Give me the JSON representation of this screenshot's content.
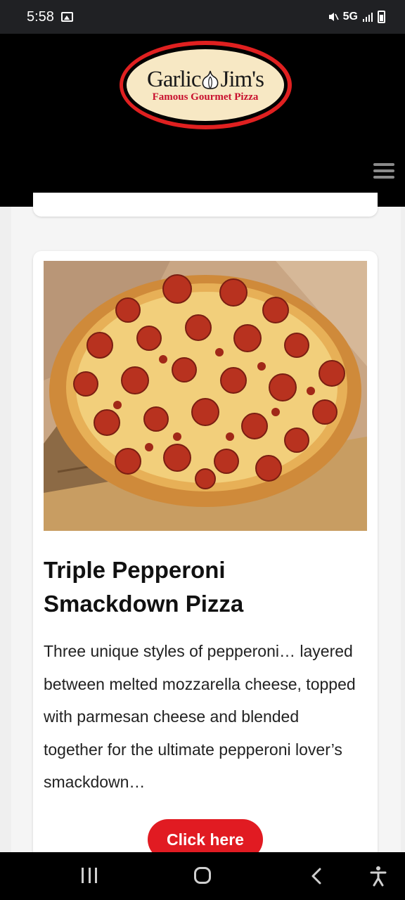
{
  "status_bar": {
    "time": "5:58",
    "network": "5G"
  },
  "header": {
    "logo_main_left": "Garlic",
    "logo_main_right": "Jim's",
    "logo_sub": "Famous Gourmet Pizza",
    "menu_icon": "hamburger-menu-icon"
  },
  "card": {
    "image_alt": "Triple Pepperoni Smackdown Pizza",
    "title": "Triple Pepperoni Smackdown Pizza",
    "description": "Three unique styles of pepperoni… layered between melted mozzarella cheese, topped with parmesan cheese and blended together for the ultimate pepperoni lover’s smackdown…",
    "button_label": "Click here"
  },
  "colors": {
    "brand_red": "#e11b22",
    "header_bg": "#000000",
    "logo_cream": "#f7e8c4"
  },
  "nav_bar": {
    "icons": [
      "recents-icon",
      "home-icon",
      "back-icon",
      "accessibility-icon"
    ]
  }
}
